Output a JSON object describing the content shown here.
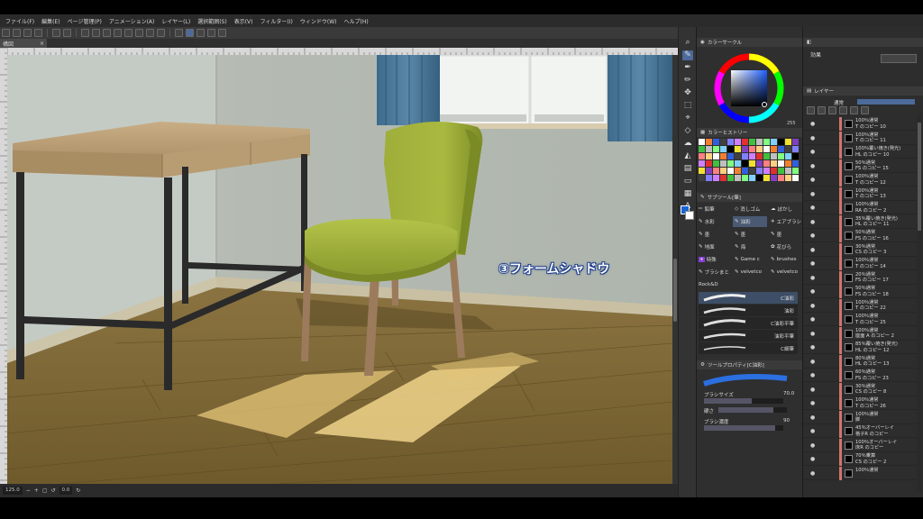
{
  "menu": {
    "items": [
      "ファイル(F)",
      "編集(E)",
      "ページ管理(P)",
      "アニメーション(A)",
      "レイヤー(L)",
      "選択範囲(S)",
      "表示(V)",
      "フィルター(I)",
      "ウィンドウ(W)",
      "ヘルプ(H)"
    ]
  },
  "canvas": {
    "tab_label": "構図",
    "annotation": "③フォームシャドウ"
  },
  "statusbar": {
    "zoom": "125.0",
    "angle": "0.0"
  },
  "color_panel": {
    "header": "カラーサークル",
    "value": "255"
  },
  "history_panel": {
    "header": "カラーヒストリー"
  },
  "subtool_panel": {
    "header": "サブツール[筆]",
    "groups": [
      [
        "鉛筆",
        "消しゴム",
        "ぼかし"
      ],
      [
        "水彩",
        "油彩",
        "エアブラシ"
      ],
      [
        "墨",
        "墨",
        "墨"
      ],
      [
        "地面",
        "海",
        "花びら"
      ],
      [
        "特殊",
        "Game c",
        "brushes"
      ],
      [
        "ブラシまと",
        "velvetco",
        "velvetco"
      ],
      [
        "Rock&D"
      ]
    ],
    "brushes": [
      "C油彩",
      "油彩",
      "C油彩平筆",
      "油彩平筆",
      "C細筆"
    ]
  },
  "tool_property": {
    "header": "ツールプロパティ[C油彩]",
    "brush_size_label": "ブラシサイズ",
    "brush_size_value": "70.0",
    "hardness_label": "硬さ",
    "density_label": "ブラシ濃度",
    "density_value": "90"
  },
  "right_panel": {
    "top_tab": "効果",
    "layer_tab": "レイヤー",
    "blend_mode": "通常"
  },
  "layers": [
    {
      "label": "100％通常\nT のコピー 10",
      "visible": true
    },
    {
      "label": "100％通常\nT のコピー 11",
      "visible": true
    },
    {
      "label": "100％覆い焼き(発光)\nHL のコピー 10",
      "visible": true
    },
    {
      "label": "50％通常\nFS のコピー 15",
      "visible": true
    },
    {
      "label": "100％通常\nT のコピー 12",
      "visible": true
    },
    {
      "label": "100％通常\nT のコピー 13",
      "visible": true
    },
    {
      "label": "100％通常\nRA のコピー 2",
      "visible": true
    },
    {
      "label": "35％覆い焼き(発光)\nHL のコピー 11",
      "visible": true
    },
    {
      "label": "50％通常\nFS のコピー 16",
      "visible": true
    },
    {
      "label": "30％通常\nCS のコピー 3",
      "visible": true
    },
    {
      "label": "100％通常\nT のコピー 14",
      "visible": true
    },
    {
      "label": "20％通常\nFS のコピー 17",
      "visible": true
    },
    {
      "label": "50％通常\nFS のコピー 18",
      "visible": true
    },
    {
      "label": "100％通常\nT のコピー 22",
      "visible": true
    },
    {
      "label": "100％通常\nT のコピー 25",
      "visible": true
    },
    {
      "label": "100％通常\n座面 A のコピー 2",
      "visible": true
    },
    {
      "label": "85％覆い焼き(発光)\nHL のコピー 12",
      "visible": true
    },
    {
      "label": "80％通常\nHL のコピー 13",
      "visible": true
    },
    {
      "label": "60％通常\nFS のコピー 23",
      "visible": true
    },
    {
      "label": "30％通常\nCS のコピー 8",
      "visible": true
    },
    {
      "label": "100％通常\nT のコピー 26",
      "visible": true
    },
    {
      "label": "100％通常\n脚",
      "visible": true
    },
    {
      "label": "45％オーバーレイ\n格子R のコピー",
      "visible": true
    },
    {
      "label": "100％オーバーレイ\n床R のコピー",
      "visible": true
    },
    {
      "label": "70％乗算\nCS のコピー 2",
      "visible": true
    },
    {
      "label": "100％通常",
      "visible": true
    }
  ]
}
